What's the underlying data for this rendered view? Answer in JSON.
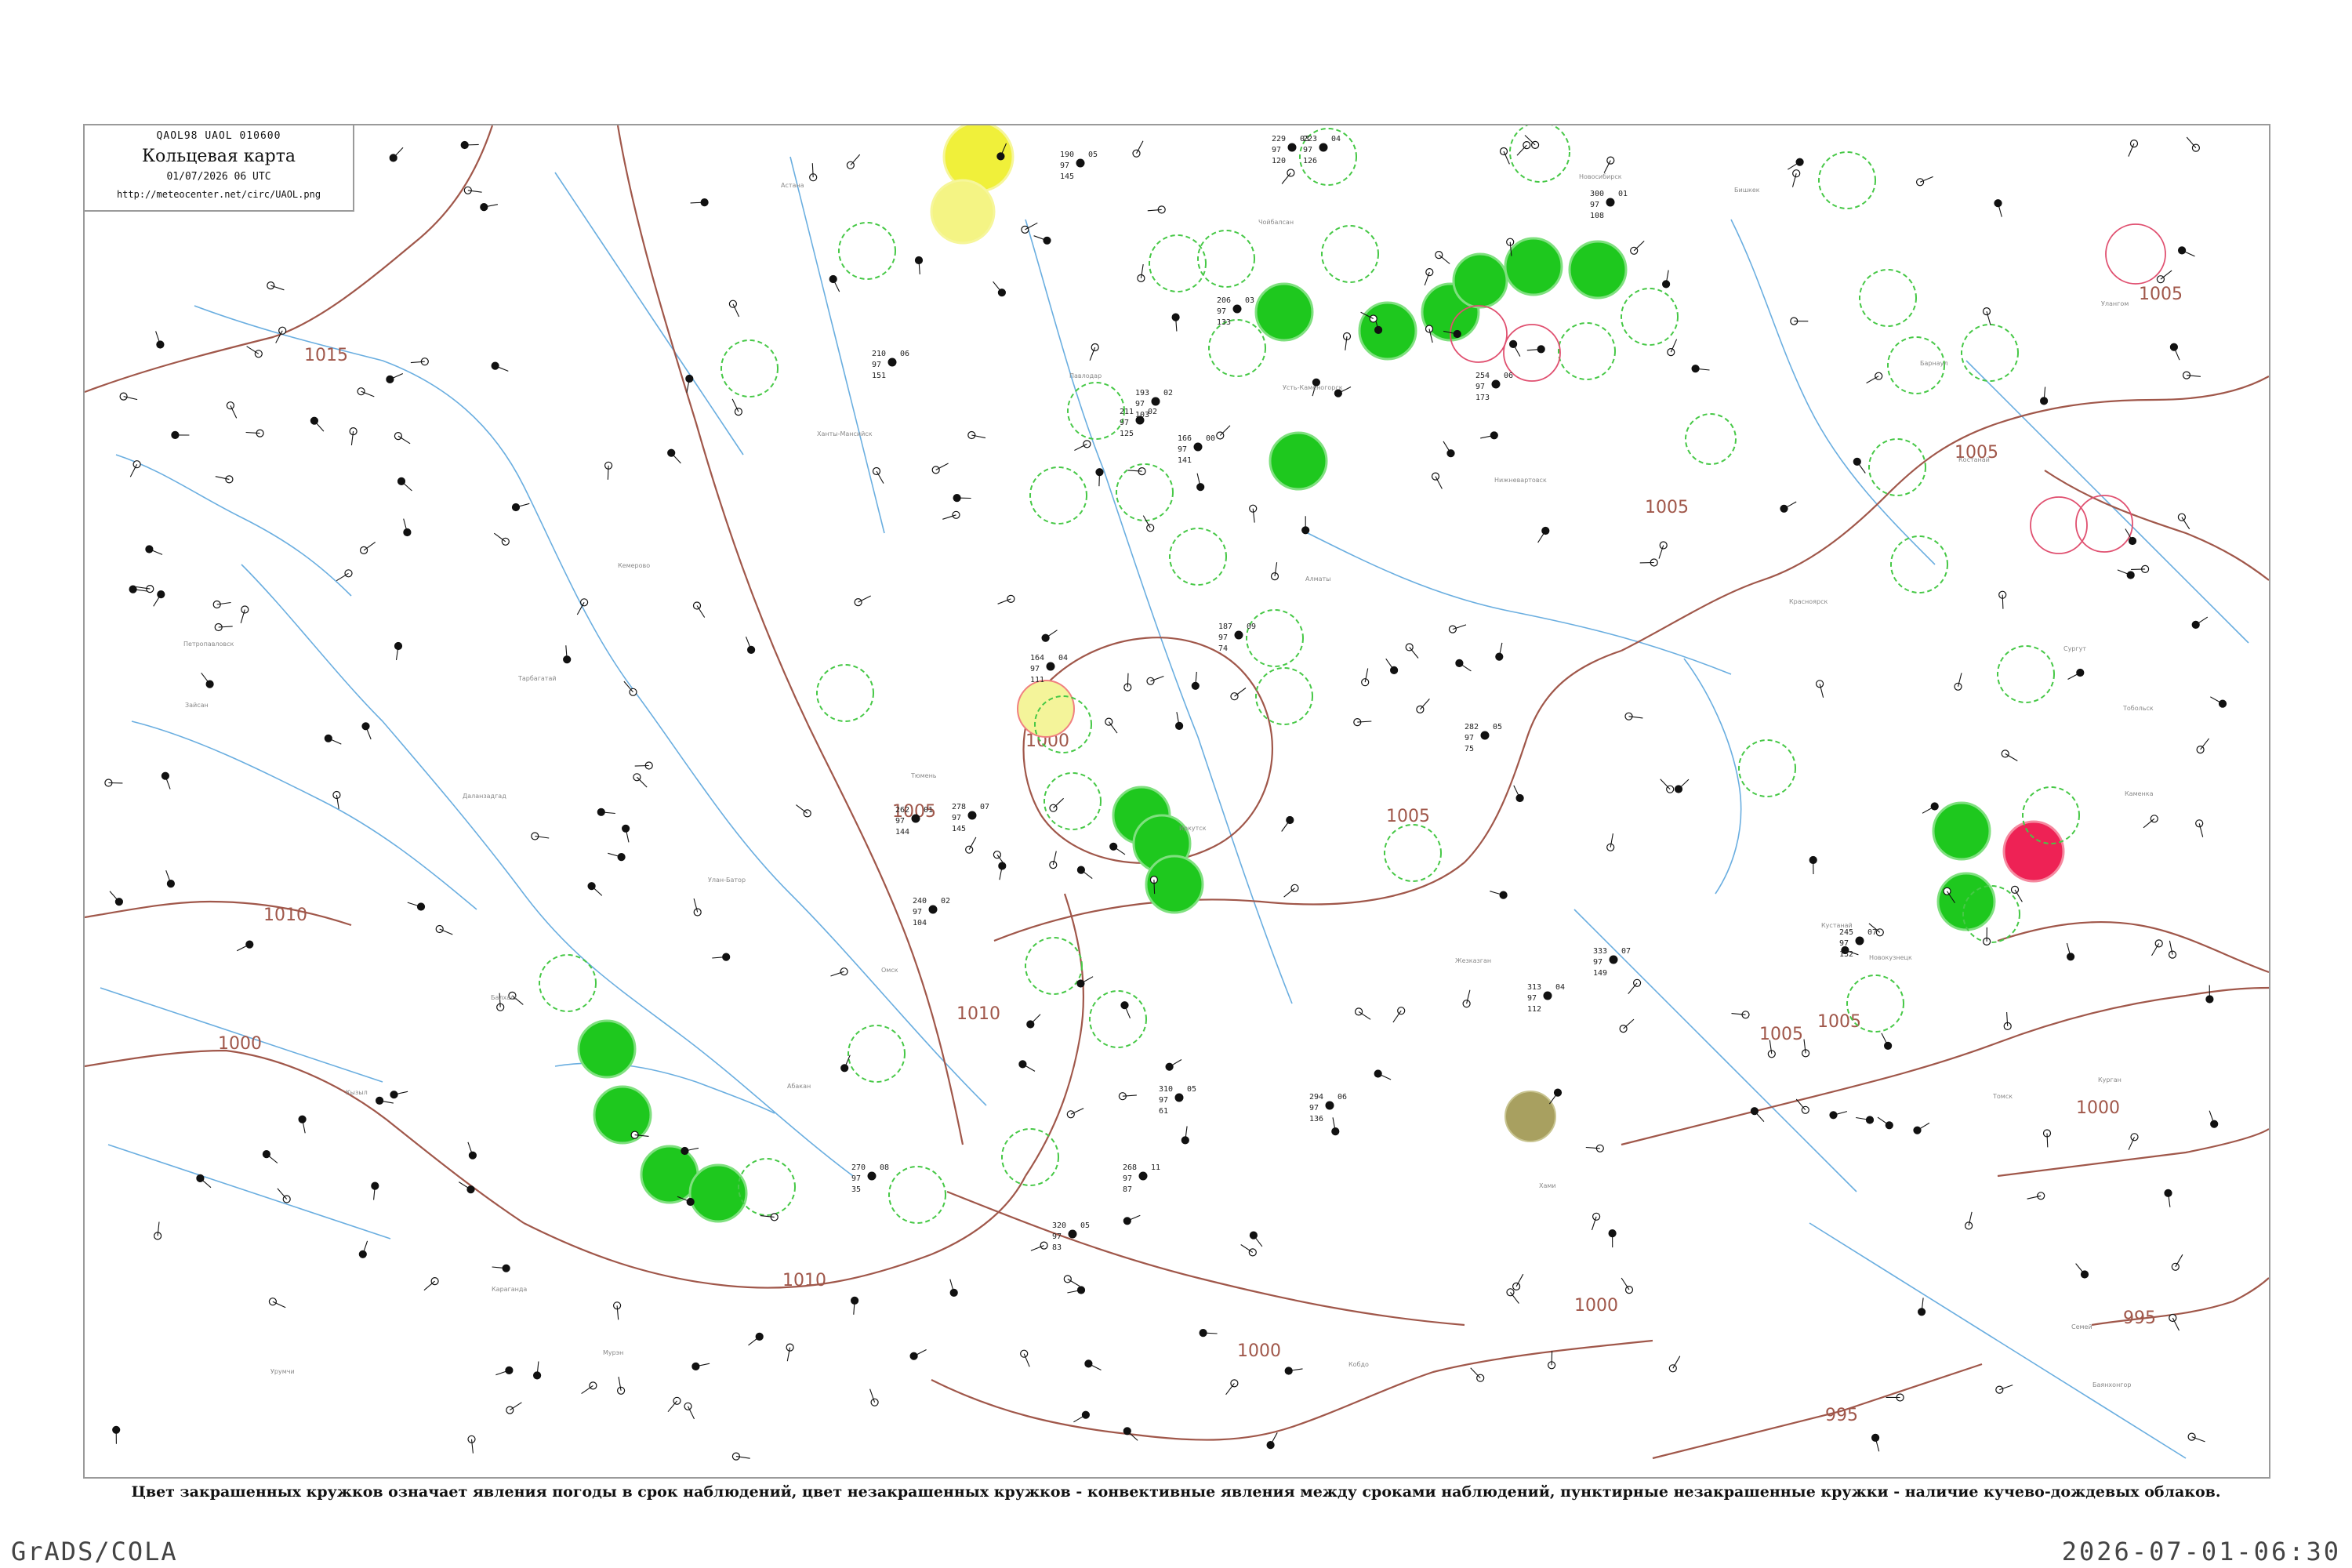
{
  "header": {
    "code_line": "QAOL98  UAOL  010600",
    "title": "Кольцевая карта",
    "datetime": "01/07/2026 06 UTC",
    "url": "http://meteocenter.net/circ/UAOL.png"
  },
  "legend": {
    "text": "Цвет закрашенных кружков означает явления погоды в срок наблюдений, цвет незакрашенных кружков - конвективные явления между сроками наблюдений, пунктирные незакрашенные кружки - наличие кучево-дождевых облаков."
  },
  "footer": {
    "left": "GrADS/COLA",
    "right": "2026-07-01-06:30"
  },
  "colors": {
    "isobar": "#a0574a",
    "river": "#6aaee0",
    "rain": "#1ec81e",
    "rain_dashed": "#46c846",
    "fog_haze": "#f0f03a",
    "thunder": "#ee2255",
    "dust": "#a8a060",
    "station": "#111111",
    "frame": "#9a9a9a"
  },
  "isobar_labels": [
    {
      "name": "isobar-1015",
      "text": "1015"
    },
    {
      "name": "isobar-1010-west",
      "text": "1010"
    },
    {
      "name": "isobar-1000-west",
      "text": "1000"
    },
    {
      "name": "isobar-1005-center",
      "text": "1005"
    },
    {
      "name": "isobar-1010-center",
      "text": "1010"
    },
    {
      "name": "isobar-1010-south",
      "text": "1010"
    },
    {
      "name": "isobar-1000-center",
      "text": "1000"
    },
    {
      "name": "isobar-1005-mid",
      "text": "1005"
    },
    {
      "name": "isobar-1005-north",
      "text": "1005"
    },
    {
      "name": "isobar-1005-east",
      "text": "1005"
    },
    {
      "name": "isobar-1005-far-east",
      "text": "1005"
    },
    {
      "name": "isobar-1005-southeast",
      "text": "1005"
    },
    {
      "name": "isobar-1005-south",
      "text": "1005"
    },
    {
      "name": "isobar-1000-south",
      "text": "1000"
    },
    {
      "name": "isobar-1000-bottom",
      "text": "1000"
    },
    {
      "name": "isobar-1000-southeast",
      "text": "1000"
    },
    {
      "name": "isobar-995",
      "text": "995"
    },
    {
      "name": "isobar-995-east",
      "text": "995"
    }
  ],
  "stations": [
    {
      "name": "station-1",
      "p": "229",
      "t": "97",
      "d": "120",
      "c": "03"
    },
    {
      "name": "station-2",
      "p": "223",
      "t": "97",
      "d": "126",
      "c": "04"
    },
    {
      "name": "station-3",
      "p": "190",
      "t": "97",
      "d": "145",
      "c": "05"
    },
    {
      "name": "station-4",
      "p": "210",
      "t": "97",
      "d": "151",
      "c": "06"
    },
    {
      "name": "station-5",
      "p": "278",
      "t": "97",
      "d": "145",
      "c": "07"
    },
    {
      "name": "station-6",
      "p": "262",
      "t": "97",
      "d": "144",
      "c": "01"
    },
    {
      "name": "station-7",
      "p": "240",
      "t": "97",
      "d": "104",
      "c": "02"
    },
    {
      "name": "station-8",
      "p": "268",
      "t": "97",
      "d": "87",
      "c": "11"
    },
    {
      "name": "station-9",
      "p": "294",
      "t": "97",
      "d": "136",
      "c": "06"
    },
    {
      "name": "station-10",
      "p": "313",
      "t": "97",
      "d": "112",
      "c": "04"
    },
    {
      "name": "station-11",
      "p": "282",
      "t": "97",
      "d": "75",
      "c": "05"
    },
    {
      "name": "station-12",
      "p": "164",
      "t": "97",
      "d": "111",
      "c": "04"
    },
    {
      "name": "station-13",
      "p": "187",
      "t": "97",
      "d": "74",
      "c": "09"
    },
    {
      "name": "station-14",
      "p": "206",
      "t": "97",
      "d": "133",
      "c": "03"
    },
    {
      "name": "station-15",
      "p": "300",
      "t": "97",
      "d": "108",
      "c": "01"
    },
    {
      "name": "station-16",
      "p": "254",
      "t": "97",
      "d": "173",
      "c": "06"
    },
    {
      "name": "station-17",
      "p": "211",
      "t": "97",
      "d": "125",
      "c": "02"
    },
    {
      "name": "station-18",
      "p": "166",
      "t": "97",
      "d": "141",
      "c": "00"
    },
    {
      "name": "station-19",
      "p": "270",
      "t": "97",
      "d": "35",
      "c": "08"
    },
    {
      "name": "station-20",
      "p": "310",
      "t": "97",
      "d": "61",
      "c": "05"
    },
    {
      "name": "station-21",
      "p": "320",
      "t": "97",
      "d": "83",
      "c": "05"
    },
    {
      "name": "station-22",
      "p": "333",
      "t": "97",
      "d": "149",
      "c": "07"
    },
    {
      "name": "station-23",
      "p": "245",
      "t": "97",
      "d": "132",
      "c": "07"
    },
    {
      "name": "station-24",
      "p": "193",
      "t": "97",
      "d": "103",
      "c": "02"
    }
  ],
  "place_names": [
    "Ханты-Мансийск",
    "Сургут",
    "Нижневартовск",
    "Тобольск",
    "Тюмень",
    "Курган",
    "Омск",
    "Новосибирск",
    "Томск",
    "Барнаул",
    "Кемерово",
    "Новокузнецк",
    "Красноярск",
    "Абакан",
    "Кызыл",
    "Иркутск",
    "Улан-Батор",
    "Петропавловск",
    "Астана",
    "Павлодар",
    "Семей",
    "Усть-Каменогорск",
    "Караганда",
    "Балхаш",
    "Алматы",
    "Бишкек",
    "Урумчи",
    "Хами",
    "Кобдо",
    "Улангом",
    "Мурэн",
    "Баянхонгор",
    "Даланзадгад",
    "Чойбалсан",
    "Тарбагатай",
    "Зайсан",
    "Каменка",
    "Жезказган",
    "Костанай",
    "Кустанай"
  ]
}
